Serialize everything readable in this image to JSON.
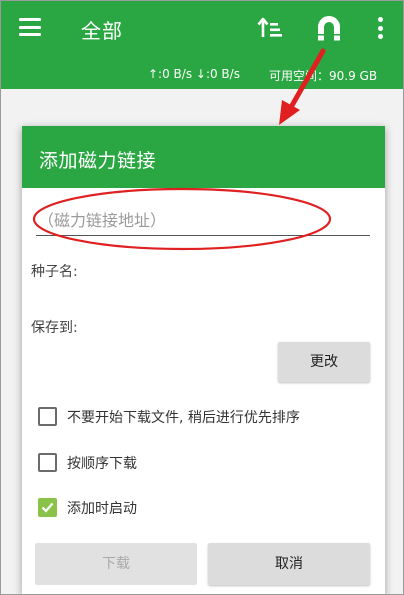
{
  "appbar": {
    "title": "全部",
    "icons": [
      "menu-icon",
      "sort-icon",
      "magnet-icon",
      "more-vert-icon"
    ]
  },
  "statusbar": {
    "speed": "↑:0 B/s ↓:0 B/s",
    "free_space": "可用空间：90.9 GB"
  },
  "dialog": {
    "title": "添加磁力链接",
    "magnet_placeholder": "（磁力链接地址）",
    "magnet_value": "",
    "torrent_name_label": "种子名:",
    "save_to_label": "保存到:",
    "change_button": "更改",
    "options": [
      {
        "label": "不要开始下载文件, 稍后进行优先排序",
        "checked": false
      },
      {
        "label": "按顺序下载",
        "checked": false
      },
      {
        "label": "添加时启动",
        "checked": true
      }
    ],
    "download_button": "下载",
    "download_enabled": false,
    "cancel_button": "取消"
  },
  "colors": {
    "primary": "#2aa742",
    "checkbox_checked": "#8bc34a",
    "annotation": "#e02020"
  }
}
